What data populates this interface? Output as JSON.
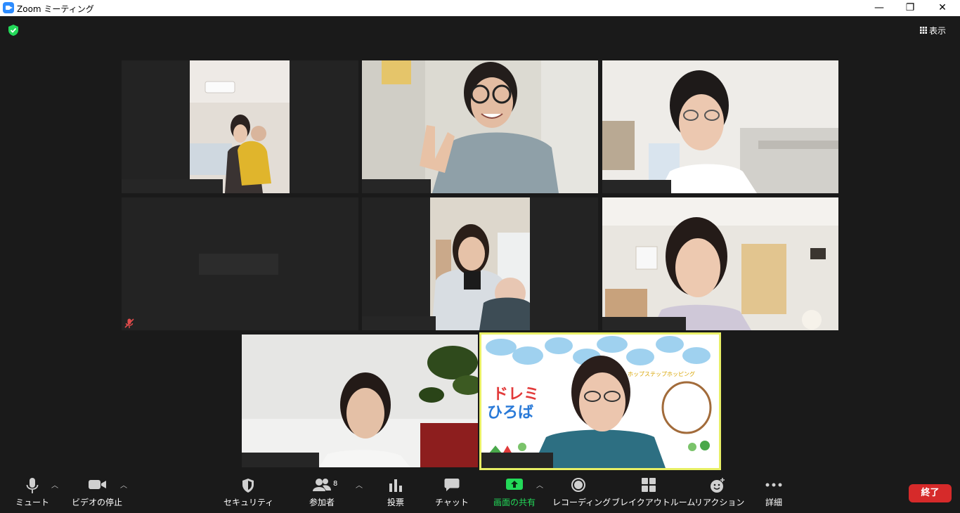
{
  "window": {
    "title": "Zoom ミーティング",
    "minimize": "—",
    "restore": "❐",
    "close": "✕"
  },
  "header": {
    "view_label": "表示"
  },
  "toolbar": {
    "mute_label": "ミュート",
    "video_label": "ビデオの停止",
    "security_label": "セキュリティ",
    "participants_label": "参加者",
    "participants_count": "8",
    "polls_label": "投票",
    "chat_label": "チャット",
    "share_label": "画面の共有",
    "record_label": "レコーディング",
    "breakout_label": "ブレイクアウトルーム",
    "reactions_label": "リアクション",
    "more_label": "詳細",
    "end_label": "終了"
  },
  "colors": {
    "background": "#1a1a1a",
    "tile": "#232323",
    "accent_green": "#23d959",
    "end_red": "#d62a2a",
    "active_speaker": "#e8ef65"
  },
  "shared_screen": {
    "title_line1": "ドレミ",
    "title_line2": "ひろば",
    "subtitle": "ホップステップホッピング"
  }
}
